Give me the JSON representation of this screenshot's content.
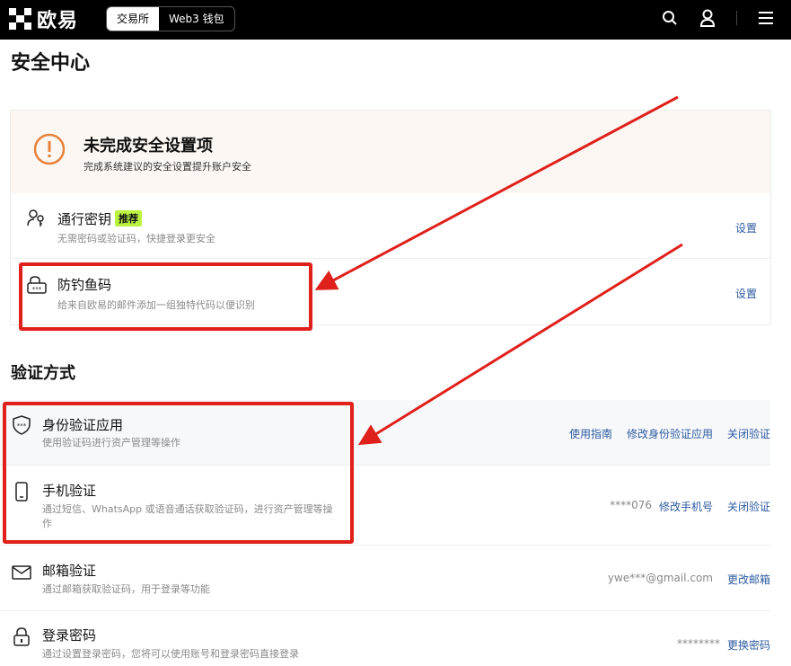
{
  "topbar": {
    "logo_text": "欧易",
    "tabs": [
      {
        "label": "交易所",
        "active": true
      },
      {
        "label": "Web3 钱包",
        "active": false
      }
    ],
    "icons": [
      "search-icon",
      "user-icon",
      "menu-icon"
    ]
  },
  "page_title": "安全中心",
  "security_card": {
    "banner_title": "未完成安全设置项",
    "banner_subtitle": "完成系统建议的安全设置提升账户安全",
    "items": [
      {
        "icon": "passkey-icon",
        "title": "通行密钥",
        "badge": "推荐",
        "subtitle": "无需密码或验证码，快捷登录更安全",
        "action": "设置"
      },
      {
        "icon": "anti-phishing-icon",
        "title": "防钓鱼码",
        "subtitle": "给来自欧易的邮件添加一组独特代码以便识别",
        "action": "设置"
      }
    ]
  },
  "verification": {
    "section_title": "验证方式",
    "items": [
      {
        "icon": "shield-icon",
        "title": "身份验证应用",
        "subtitle": "使用验证码进行资产管理等操作",
        "actions": [
          "使用指南",
          "修改身份验证应用",
          "关闭验证"
        ]
      },
      {
        "icon": "phone-icon",
        "title": "手机验证",
        "subtitle": "通过短信、WhatsApp 或语音通话获取验证码，进行资产管理等操作",
        "value": "****076",
        "actions": [
          "修改手机号",
          "关闭验证"
        ]
      },
      {
        "icon": "mail-icon",
        "title": "邮箱验证",
        "subtitle": "通过邮箱获取验证码，用于登录等功能",
        "value": "ywe***@gmail.com",
        "actions": [
          "更改邮箱"
        ]
      },
      {
        "icon": "lock-icon",
        "title": "登录密码",
        "subtitle": "通过设置登录密码，您将可以使用账号和登录密码直接登录",
        "value": "********",
        "actions": [
          "更换密码"
        ]
      }
    ]
  },
  "colors": {
    "accent_link": "#2c5aa0",
    "warning": "#e8823a",
    "highlight": "#e0201b",
    "badge": "#b9f33f"
  }
}
